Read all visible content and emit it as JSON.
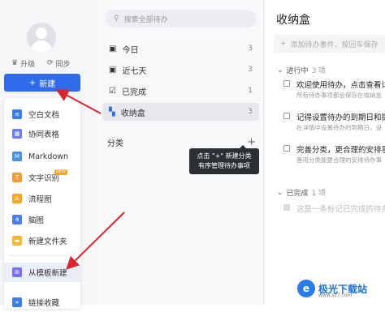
{
  "sidebar": {
    "upgrade_label": "升级",
    "sync_label": "同步",
    "new_button_label": "新建",
    "menu_items": [
      {
        "label": "空白文档",
        "icon": "doc-icon",
        "color": "#3d7bf5",
        "glyph": "≡"
      },
      {
        "label": "协同表格",
        "icon": "table-icon",
        "color": "#6b7cf7",
        "glyph": "▦"
      },
      {
        "label": "Markdown",
        "icon": "markdown-icon",
        "color": "#4a90e2",
        "glyph": "M↓"
      },
      {
        "label": "文字识别",
        "icon": "ocr-icon",
        "color": "#f29c38",
        "glyph": "T",
        "badge": "NEW"
      },
      {
        "label": "流程图",
        "icon": "flowchart-icon",
        "color": "#f5a623",
        "glyph": "⟁"
      },
      {
        "label": "脑图",
        "icon": "mindmap-icon",
        "color": "#4a7df0",
        "glyph": "⋔"
      },
      {
        "label": "新建文件夹",
        "icon": "folder-icon",
        "color": "#f7b733",
        "glyph": "▬"
      },
      {
        "label": "从模板新建",
        "icon": "template-icon",
        "color": "#7a6ff0",
        "glyph": "⊞"
      },
      {
        "label": "链接收藏",
        "icon": "link-icon",
        "color": "#3d7bf5",
        "glyph": "∞"
      }
    ]
  },
  "middle": {
    "search_placeholder": "搜索全部待办",
    "nav_items": [
      {
        "label": "今日",
        "count": "3",
        "icon": "calendar-today-icon"
      },
      {
        "label": "近七天",
        "count": "3",
        "icon": "calendar-week-icon"
      },
      {
        "label": "已完成",
        "count": "1",
        "icon": "check-square-icon"
      },
      {
        "label": "收纳盒",
        "count": "3",
        "icon": "inbox-grid-icon"
      }
    ],
    "category_label": "分类",
    "tooltip_line1": "点击 \"+\" 新建分类",
    "tooltip_line2": "有序管理待办事项"
  },
  "inbox": {
    "title": "收纳盒",
    "add_placeholder": "添加待办事件，按回车保存",
    "in_progress_label": "进行中",
    "in_progress_count": "3 项",
    "tasks": [
      {
        "title": "欢迎使用待办，点击查看详",
        "sub": "所有待办事项都会保存在收纳盒"
      },
      {
        "title": "记得设置待办的到期日和提",
        "sub": "在详情中设置待办的到期日，设"
      },
      {
        "title": "完善分类，更合理的安排事",
        "sub": "善用分类能更合理的安排待办事"
      }
    ],
    "completed_label": "已完成",
    "completed_count": "1 项",
    "done_tasks": [
      {
        "title": "这是一条标记已完成的待办"
      }
    ]
  },
  "watermark": {
    "text": "极光下载站",
    "sub": "www.xz7.com"
  },
  "colors": {
    "accent": "#2f6bea",
    "arrow": "#d9262c"
  }
}
